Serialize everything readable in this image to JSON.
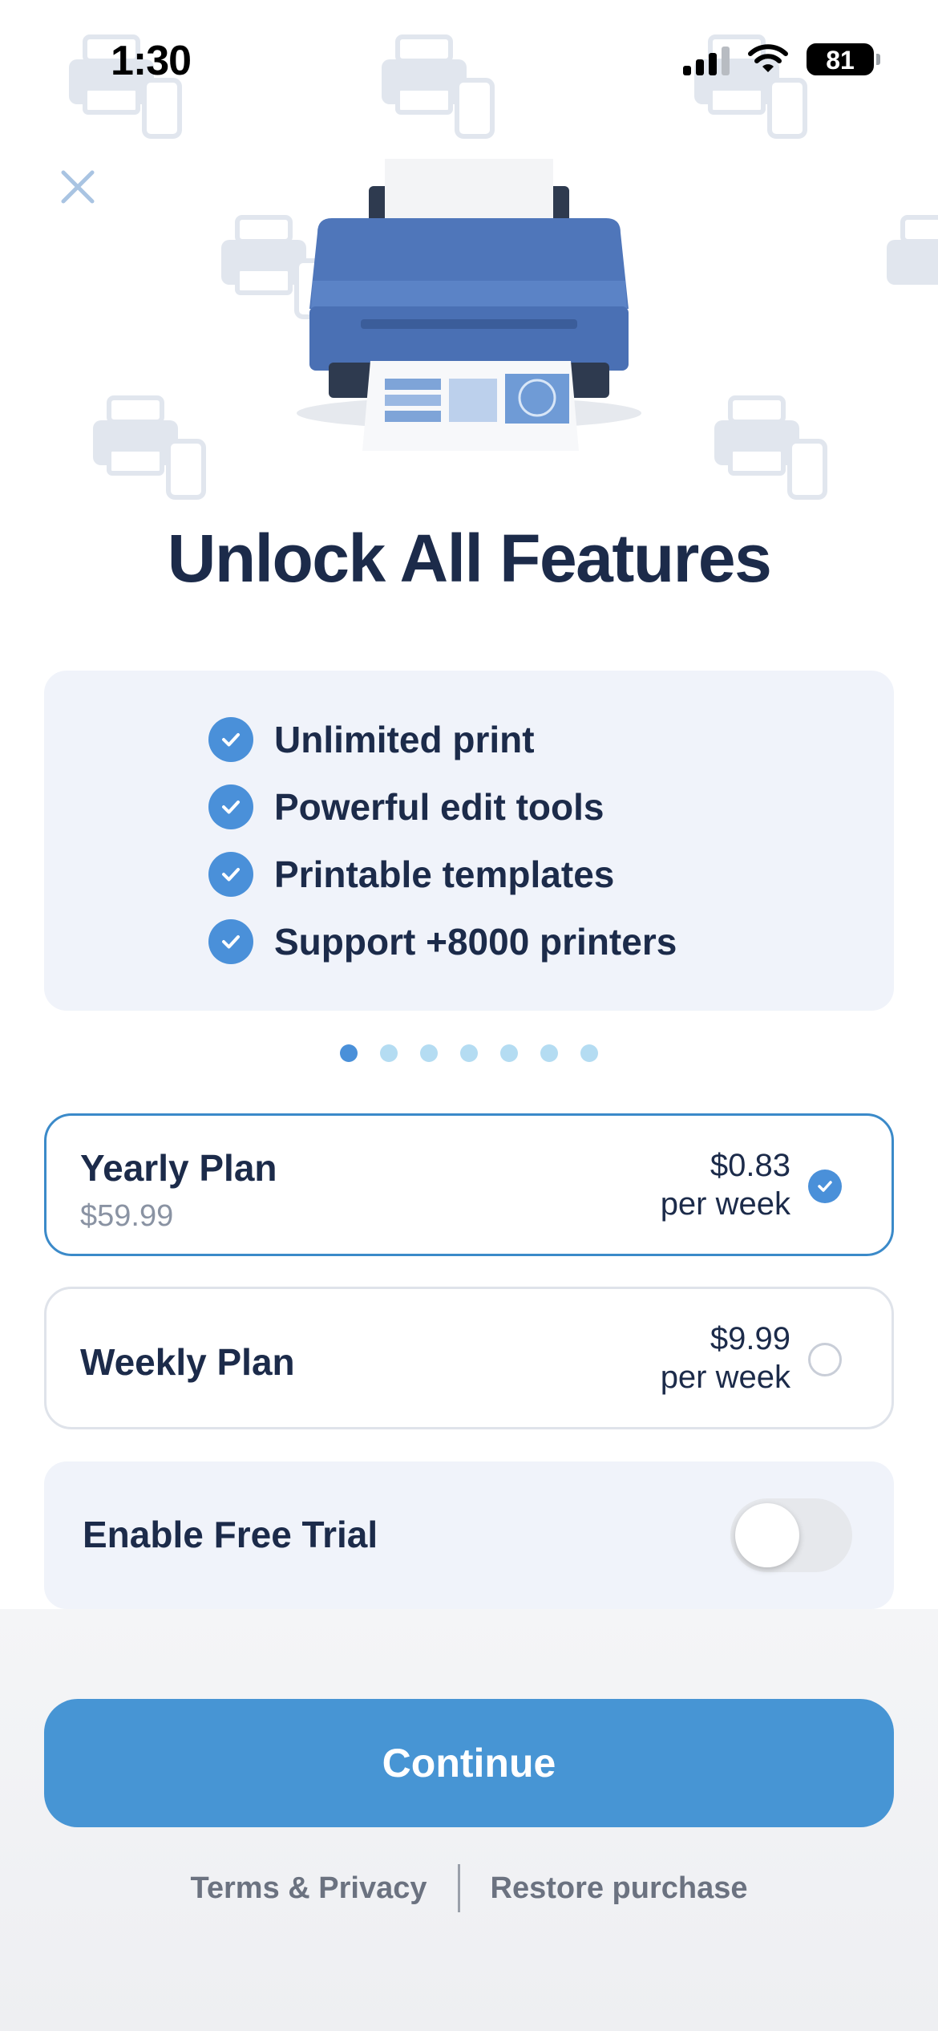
{
  "status_bar": {
    "time": "1:30",
    "battery": "81",
    "icons": [
      "cellular-signal-icon",
      "wifi-icon",
      "battery-icon"
    ]
  },
  "close_icon": "close-icon",
  "hero_image": "printer-illustration",
  "title": "Unlock All Features",
  "features": [
    {
      "label": "Unlimited print"
    },
    {
      "label": "Powerful edit tools"
    },
    {
      "label": "Printable templates"
    },
    {
      "label": "Support +8000 printers"
    }
  ],
  "pager": {
    "count": 7,
    "active_index": 0
  },
  "plans": [
    {
      "name": "Yearly Plan",
      "subtitle": "$59.99",
      "price": "$0.83",
      "period": "per week",
      "selected": true
    },
    {
      "name": "Weekly Plan",
      "subtitle": "",
      "price": "$9.99",
      "period": "per week",
      "selected": false
    }
  ],
  "free_trial": {
    "label": "Enable Free Trial",
    "enabled": false
  },
  "continue_label": "Continue",
  "footer": {
    "terms": "Terms & Privacy",
    "restore": "Restore purchase"
  },
  "colors": {
    "accent": "#4795d4",
    "title": "#1c2b4a",
    "card_bg": "#f0f3fa",
    "dot_inactive": "#b4dcf2"
  }
}
